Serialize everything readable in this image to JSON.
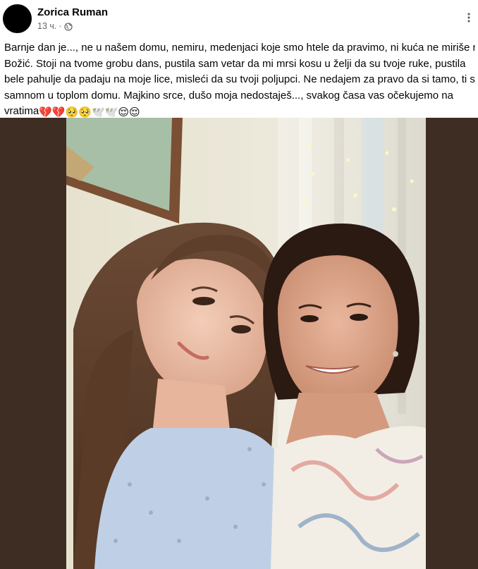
{
  "post": {
    "author": "Zorica Ruman",
    "time": "13 ч.",
    "separator": "·",
    "privacy_icon": "globe-icon",
    "more_icon": "more-vertical-icon",
    "text_lines": [
      "Barnje dan je..., ne u našem domu, nemiru, medenjaci koje smo htele da pravimo, ni kuća ne miriše na",
      "Božić. Stoji na tvome grobu dans, pustila sam vetar da mi mrsi kosu u želji da su tvoje ruke, pustila",
      "bele pahulje da padaju na moje lice, misleći da su tvoji poljupci. Ne nedajem za pravo da si tamo, ti si",
      "samnom u toplom domu. Majkino srce, dušo moja nedostaješ..., svakog časa vas očekujemo na",
      "vratima"
    ],
    "emojis": [
      "💔",
      "💔",
      "🥺",
      "🥺",
      "🕊️",
      "🕊️",
      "😌",
      "😌"
    ]
  },
  "colors": {
    "text": "#050505",
    "meta": "#65676b",
    "photo_background": "#3e2d22"
  }
}
